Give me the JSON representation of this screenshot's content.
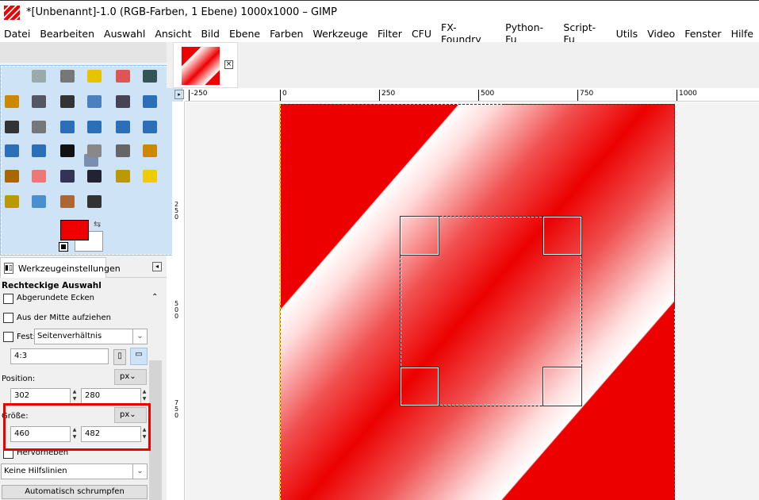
{
  "window": {
    "title": "*[Unbenannt]-1.0 (RGB-Farben, 1 Ebene) 1000x1000 – GIMP"
  },
  "menu": [
    "Datei",
    "Bearbeiten",
    "Auswahl",
    "Ansicht",
    "Bild",
    "Ebene",
    "Farben",
    "Werkzeuge",
    "Filter",
    "CFU",
    "FX-Foundry",
    "Python-Fu",
    "Script-Fu",
    "Utils",
    "Video",
    "Fenster",
    "Hilfe"
  ],
  "tools": [
    {
      "name": "rect-select",
      "color": "#7a8fb0"
    },
    {
      "name": "ellipse-select",
      "color": "#9aa"
    },
    {
      "name": "free-select",
      "color": "#777"
    },
    {
      "name": "fuzzy-select",
      "color": "#e9c200"
    },
    {
      "name": "select-by-color",
      "color": "#d55"
    },
    {
      "name": "scissors",
      "color": "#355"
    },
    {
      "name": "foreground-select",
      "color": "#c80"
    },
    {
      "name": "paths",
      "color": "#556"
    },
    {
      "name": "color-picker",
      "color": "#333"
    },
    {
      "name": "zoom",
      "color": "#4a7fc0"
    },
    {
      "name": "measure",
      "color": "#445"
    },
    {
      "name": "move",
      "color": "#2a6fb8"
    },
    {
      "name": "align",
      "color": "#333"
    },
    {
      "name": "crop",
      "color": "#777"
    },
    {
      "name": "rotate",
      "color": "#2a6fb8"
    },
    {
      "name": "scale",
      "color": "#2a6fb8"
    },
    {
      "name": "shear",
      "color": "#2a6fb8"
    },
    {
      "name": "perspective",
      "color": "#2a6fb8"
    },
    {
      "name": "flip",
      "color": "#2a6fb8"
    },
    {
      "name": "cage-transform",
      "color": "#2a6fb8"
    },
    {
      "name": "text",
      "color": "#111"
    },
    {
      "name": "bucket-fill",
      "color": "#888"
    },
    {
      "name": "blend",
      "color": "#666"
    },
    {
      "name": "pencil",
      "color": "#c80"
    },
    {
      "name": "paintbrush",
      "color": "#a60"
    },
    {
      "name": "eraser",
      "color": "#e77"
    },
    {
      "name": "airbrush",
      "color": "#335"
    },
    {
      "name": "ink",
      "color": "#223"
    },
    {
      "name": "clone",
      "color": "#b90"
    },
    {
      "name": "heal",
      "color": "#ec0"
    },
    {
      "name": "perspective-clone",
      "color": "#b90"
    },
    {
      "name": "blur",
      "color": "#4a8fd0"
    },
    {
      "name": "smudge",
      "color": "#a63"
    },
    {
      "name": "dodge-burn",
      "color": "#333"
    }
  ],
  "colors": {
    "foreground": "#ee0000",
    "background": "#ffffff"
  },
  "tool_options": {
    "tab_label": "Werkzeugeinstellungen",
    "heading": "Rechteckige Auswahl",
    "rounded_corners": "Abgerundete Ecken",
    "expand_from_center": "Aus der Mitte aufziehen",
    "fixed_label": "Fest:",
    "fixed_mode": "Seitenverhältnis",
    "ratio": "4:3",
    "position_label": "Position:",
    "position_unit": "px",
    "position_x": "302",
    "position_y": "280",
    "size_label": "Größe:",
    "size_unit": "px",
    "size_w": "460",
    "size_h": "482",
    "highlight": "Hervorheben",
    "guides": "Keine Hilfslinien",
    "auto_shrink": "Automatisch schrumpfen"
  },
  "rulers": {
    "h": [
      "-250",
      "0",
      "250",
      "500",
      "750",
      "1000"
    ],
    "v": [
      "250",
      "500",
      "750"
    ]
  }
}
